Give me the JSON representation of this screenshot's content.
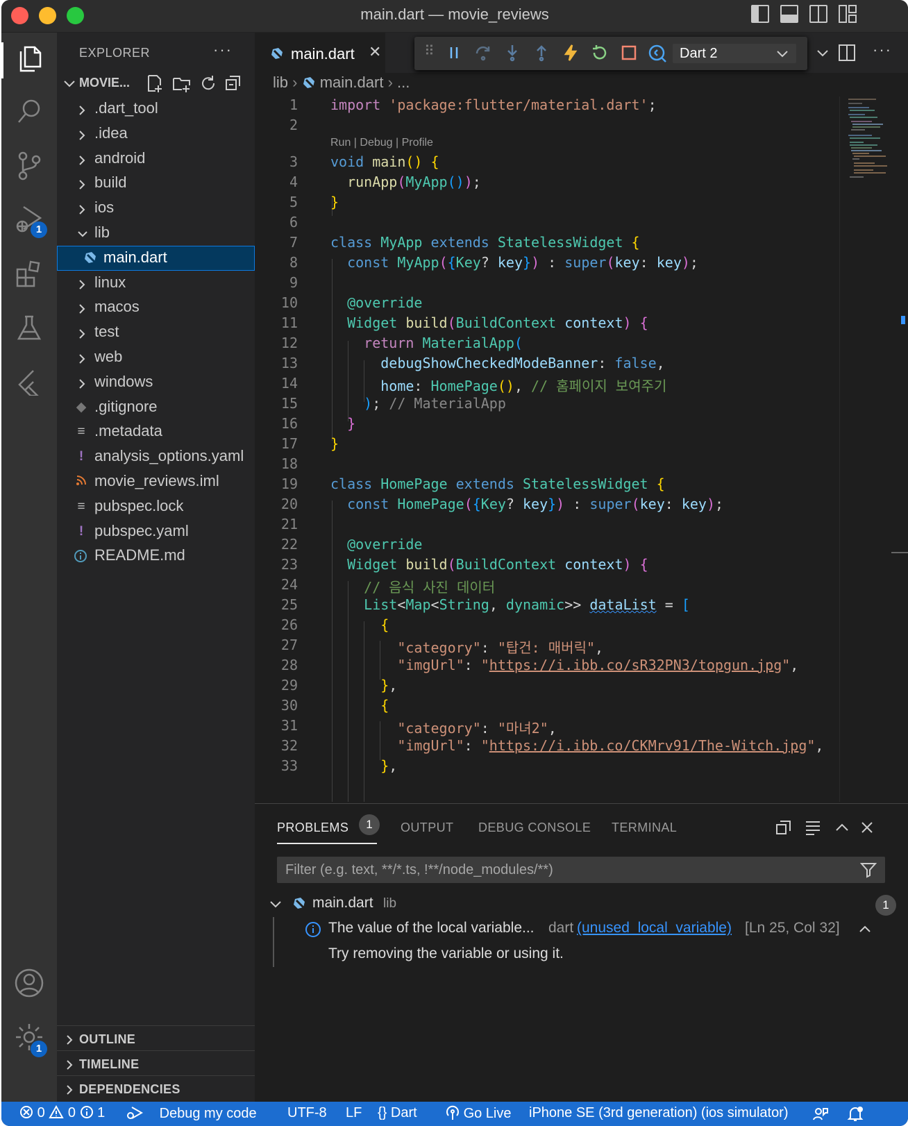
{
  "window": {
    "title": "main.dart — movie_reviews"
  },
  "activity_bar": {
    "run_badge": "1",
    "settings_badge": "1"
  },
  "explorer": {
    "header": "EXPLORER",
    "project": "MOVIE...",
    "tree": [
      {
        "name": ".dart_tool",
        "type": "folder"
      },
      {
        "name": ".idea",
        "type": "folder"
      },
      {
        "name": "android",
        "type": "folder"
      },
      {
        "name": "build",
        "type": "folder"
      },
      {
        "name": "ios",
        "type": "folder"
      },
      {
        "name": "lib",
        "type": "folder-open"
      },
      {
        "name": "main.dart",
        "type": "dart-file"
      },
      {
        "name": "linux",
        "type": "folder"
      },
      {
        "name": "macos",
        "type": "folder"
      },
      {
        "name": "test",
        "type": "folder"
      },
      {
        "name": "web",
        "type": "folder"
      },
      {
        "name": "windows",
        "type": "folder"
      },
      {
        "name": ".gitignore",
        "type": "git-file"
      },
      {
        "name": ".metadata",
        "type": "text-file"
      },
      {
        "name": "analysis_options.yaml",
        "type": "yaml-file"
      },
      {
        "name": "movie_reviews.iml",
        "type": "rss-file"
      },
      {
        "name": "pubspec.lock",
        "type": "text-file"
      },
      {
        "name": "pubspec.yaml",
        "type": "yaml-file"
      },
      {
        "name": "README.md",
        "type": "info-file"
      }
    ],
    "outline": "OUTLINE",
    "timeline": "TIMELINE",
    "dependencies": "DEPENDENCIES"
  },
  "editor": {
    "tab": "main.dart",
    "debug_config": "Dart 2",
    "breadcrumb": {
      "folder": "lib",
      "file": "main.dart",
      "more": "..."
    },
    "codelens": "Run | Debug | Profile",
    "line_numbers": [
      "1",
      "2",
      "3",
      "4",
      "5",
      "6",
      "7",
      "8",
      "9",
      "10",
      "11",
      "12",
      "13",
      "14",
      "15",
      "16",
      "17",
      "18",
      "19",
      "20",
      "21",
      "22",
      "23",
      "24",
      "25",
      "26",
      "27",
      "28",
      "29",
      "30",
      "31",
      "32",
      "33"
    ],
    "code": {
      "l1a": "import",
      "l1b": "'package:flutter/material.dart'",
      "l1c": ";",
      "l3a": "void",
      "l3b": "main",
      "l3c": "()",
      "l3d": "{",
      "l4a": "runApp",
      "l4b": "(",
      "l4c": "MyApp",
      "l4d": "()",
      "l4e": ")",
      "l4f": ";",
      "l5a": "}",
      "l7a": "class",
      "l7b": "MyApp",
      "l7c": "extends",
      "l7d": "StatelessWidget",
      "l7e": "{",
      "l8a": "const",
      "l8b": "MyApp",
      "l8c": "(",
      "l8d": "{",
      "l8e": "Key",
      "l8f": "?",
      "l8g": "key",
      "l8h": "}",
      "l8i": ")",
      "l8j": ":",
      "l8k": "super",
      "l8l": "(",
      "l8m": "key",
      "l8n": ":",
      "l8o": "key",
      "l8p": ")",
      "l8q": ";",
      "l10a": "@override",
      "l11a": "Widget",
      "l11b": "build",
      "l11c": "(",
      "l11d": "BuildContext",
      "l11e": "context",
      "l11f": ")",
      "l11g": "{",
      "l12a": "return",
      "l12b": "MaterialApp",
      "l12c": "(",
      "l13a": "debugShowCheckedModeBanner",
      "l13b": ":",
      "l13c": "false",
      "l13d": ",",
      "l14a": "home",
      "l14b": ":",
      "l14c": "HomePage",
      "l14d": "()",
      "l14e": ",",
      "l14f": "// 홈페이지 보여주기",
      "l15a": ")",
      "l15b": ";",
      "l15c": "// MaterialApp",
      "l16a": "}",
      "l17a": "}",
      "l19a": "class",
      "l19b": "HomePage",
      "l19c": "extends",
      "l19d": "StatelessWidget",
      "l19e": "{",
      "l20a": "const",
      "l20b": "HomePage",
      "l20c": "(",
      "l20d": "{",
      "l20e": "Key",
      "l20f": "?",
      "l20g": "key",
      "l20h": "}",
      "l20i": ")",
      "l20j": ":",
      "l20k": "super",
      "l20l": "(",
      "l20m": "key",
      "l20n": ":",
      "l20o": "key",
      "l20p": ")",
      "l20q": ";",
      "l22a": "@override",
      "l23a": "Widget",
      "l23b": "build",
      "l23c": "(",
      "l23d": "BuildContext",
      "l23e": "context",
      "l23f": ")",
      "l23g": "{",
      "l24a": "// 음식 사진 데이터",
      "l25a": "List",
      "l25b": "<",
      "l25c": "Map",
      "l25d": "<",
      "l25e": "String",
      "l25f": ", ",
      "l25g": "dynamic",
      "l25h": ">>",
      "l25i": "dataList",
      "l25j": "=",
      "l25k": "[",
      "l26a": "{",
      "l27a": "\"category\"",
      "l27b": ":",
      "l27c": "\"탑건: 매버릭\"",
      "l27d": ",",
      "l28a": "\"imgUrl\"",
      "l28b": ":",
      "l28c": "\"",
      "l28d": "https://i.ibb.co/sR32PN3/topgun.jpg",
      "l28e": "\"",
      "l28f": ",",
      "l29a": "}",
      "l29b": ",",
      "l30a": "{",
      "l31a": "\"category\"",
      "l31b": ":",
      "l31c": "\"마녀2\"",
      "l31d": ",",
      "l32a": "\"imgUrl\"",
      "l32b": ":",
      "l32c": "\"",
      "l32d": "https://i.ibb.co/CKMrv91/The-Witch.jpg",
      "l32e": "\"",
      "l32f": ",",
      "l33a": "}",
      "l33b": ","
    }
  },
  "panel": {
    "tabs": {
      "problems": "PROBLEMS",
      "output": "OUTPUT",
      "debug_console": "DEBUG CONSOLE",
      "terminal": "TERMINAL"
    },
    "problems_count": "1",
    "filter_placeholder": "Filter (e.g. text, **/*.ts, !**/node_modules/**)",
    "file": "main.dart",
    "file_path": "lib",
    "file_count": "1",
    "problem": {
      "message": "The value of the local variable...",
      "source": "dart",
      "code": "(unused_local_variable)",
      "location": "[Ln 25, Col 32]",
      "hint": "Try removing the variable or using it."
    }
  },
  "statusbar": {
    "errors": "0",
    "warnings": "0",
    "infos": "1",
    "debug": "Debug my code",
    "encoding": "UTF-8",
    "eol": "LF",
    "language": "Dart",
    "golive": "Go Live",
    "device": "iPhone SE (3rd generation) (ios simulator)"
  },
  "colors": {
    "accent": "#1c6dd0",
    "selection": "#04395e",
    "sidebar": "#252526",
    "editor": "#1e1e1e"
  }
}
